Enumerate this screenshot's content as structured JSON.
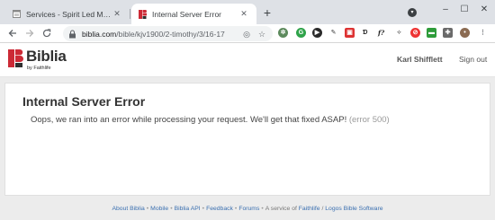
{
  "browser": {
    "tabs": [
      {
        "title": "Services - Spirit Led Ministries",
        "favicon": "window-icon"
      },
      {
        "title": "Internal Server Error",
        "favicon": "biblia-icon"
      }
    ],
    "new_tab_label": "+",
    "window_controls": {
      "minimize": "–",
      "maximize": "☐",
      "close": "✕"
    },
    "address": {
      "host": "biblia.com",
      "path": "/bible/kjv1900/2-timothy/3/16-17"
    }
  },
  "site": {
    "logo_text": "Biblia",
    "logo_sub": "by Faithlife",
    "user_name": "Karl Shifflett",
    "sign_out": "Sign out",
    "brand_color": "#cc2a36"
  },
  "error": {
    "title": "Internal Server Error",
    "message": "Oops, we ran into an error while processing your request. We'll get that fixed ASAP!",
    "code": "(error 500)"
  },
  "footer": {
    "links": [
      "About Biblia",
      "Mobile",
      "Biblia API",
      "Feedback",
      "Forums"
    ],
    "service_text": "A service of",
    "faithlife": "Faithlife",
    "slash": "/",
    "logos": "Logos Bible Software"
  }
}
